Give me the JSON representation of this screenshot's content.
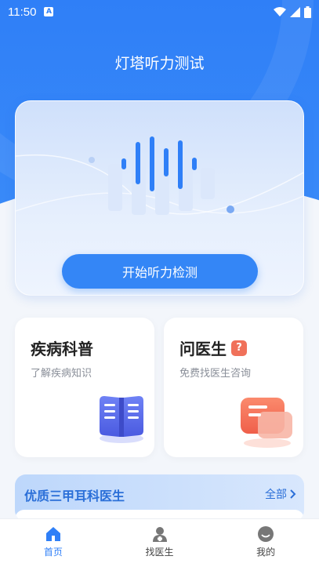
{
  "status_bar": {
    "time": "11:50",
    "a_badge": "A"
  },
  "app_title": "灯塔听力测试",
  "test_card": {
    "start_button": "开始听力检测"
  },
  "features": [
    {
      "title": "疾病科普",
      "subtitle": "了解疾病知识",
      "icon": "book-icon"
    },
    {
      "title": "问医生",
      "badge": "?",
      "subtitle": "免费找医生咨询",
      "icon": "chat-icon"
    }
  ],
  "doctor_section": {
    "title": "优质三甲耳科医生",
    "all_label": "全部"
  },
  "tabs": [
    {
      "label": "首页",
      "icon": "home-icon",
      "active": true
    },
    {
      "label": "找医生",
      "icon": "doctor-icon",
      "active": false
    },
    {
      "label": "我的",
      "icon": "profile-icon",
      "active": false
    }
  ],
  "colors": {
    "primary": "#2f7ff7",
    "accent_red": "#f0715a",
    "indigo": "#5a6ff0"
  }
}
